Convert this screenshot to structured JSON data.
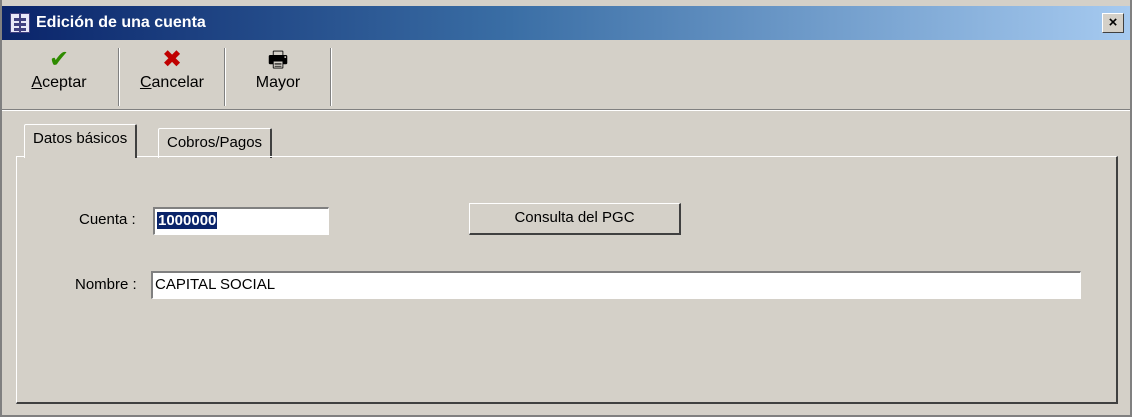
{
  "window": {
    "title": "Edición de una cuenta",
    "close_glyph": "×",
    "icon": "app-icon"
  },
  "toolbar": {
    "accept": {
      "glyph": "✔",
      "mnemonic": "A",
      "rest": "ceptar",
      "color": "#2e8b00",
      "icon": "checkmark-icon"
    },
    "cancel": {
      "glyph": "✖",
      "mnemonic": "C",
      "rest": "ancelar",
      "color": "#c00000",
      "icon": "x-icon"
    },
    "ledger": {
      "glyph": "🖶",
      "label": "Mayor",
      "icon": "printer-icon"
    }
  },
  "tabs": [
    {
      "label": "Datos básicos",
      "active": true
    },
    {
      "label": "Cobros/Pagos",
      "active": false
    }
  ],
  "form": {
    "account_label": "Cuenta :",
    "account_value": "1000000",
    "pgc_button": "Consulta del PGC",
    "name_label": "Nombre :",
    "name_value": "CAPITAL SOCIAL"
  },
  "colors": {
    "selection_bg": "#0a246a",
    "face": "#d4d0c8"
  }
}
